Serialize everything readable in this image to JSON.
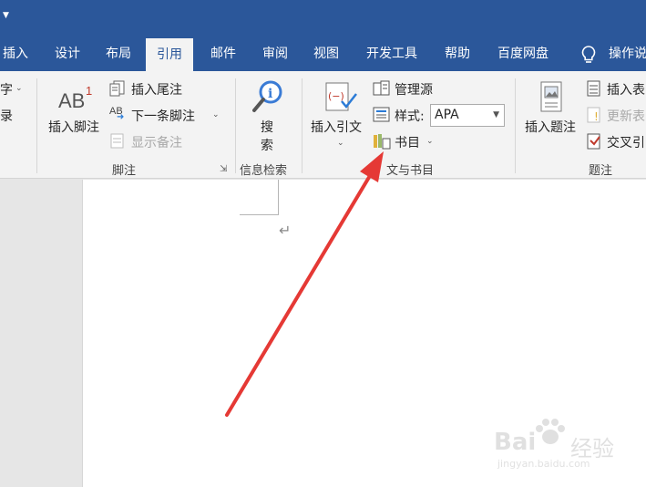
{
  "ribbon_tabs": {
    "insert": "插入",
    "design": "设计",
    "layout": "布局",
    "references": "引用",
    "mailings": "邮件",
    "review": "审阅",
    "view": "视图",
    "developer": "开发工具",
    "help": "帮助",
    "baidu_disk": "百度网盘",
    "tell_me": "操作说"
  },
  "toc_group": {
    "partial_item_1": "字",
    "partial_item_2": "录"
  },
  "footnotes": {
    "insert_footnote": "插入脚注",
    "insert_endnote": "插入尾注",
    "next_footnote": "下一条脚注",
    "show_notes": "显示备注",
    "group_label": "脚注",
    "icon_text": "AB"
  },
  "research": {
    "search": "搜",
    "search_2": "索",
    "group_label": "信息检索"
  },
  "citations": {
    "insert_citation": "插入引文",
    "manage_sources": "管理源",
    "style_label": "样式:",
    "style_value": "APA",
    "bibliography": "书目",
    "group_label": "文与书目"
  },
  "captions": {
    "insert_caption": "插入题注",
    "insert_table_of_figures": "插入表",
    "update_table": "更新表",
    "cross_reference": "交叉引",
    "group_label": "题注"
  },
  "watermark": {
    "brand": "Bai",
    "brand_tail": "经验",
    "url": "jingyan.baidu.com"
  },
  "colors": {
    "accent": "#2b579a",
    "arrow": "#e53935"
  }
}
